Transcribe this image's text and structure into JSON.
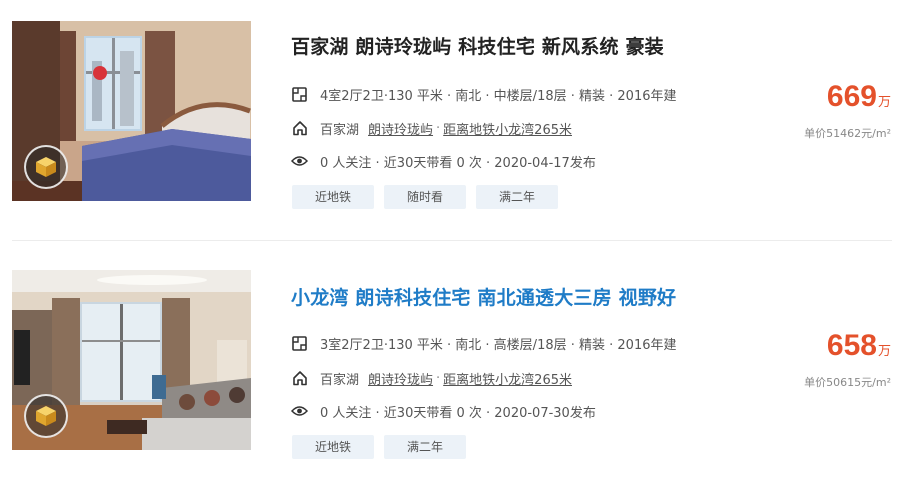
{
  "listings": [
    {
      "title": "百家湖 朗诗玲珑屿 科技住宅 新风系统 豪装",
      "house_info": "4室2厅2卫·130 平米 · 南北 · 中楼层/18层 · 精装 · 2016年建",
      "area": "百家湖",
      "community": "朗诗玲珑屿",
      "subway": "距离地铁小龙湾265米",
      "follow_info": "0 人关注 · 近30天带看 0 次 · 2020-04-17发布",
      "tags": [
        "近地铁",
        "随时看",
        "满二年"
      ],
      "total_price": "669",
      "total_unit": "万",
      "unit_price": "单价51462元/m²"
    },
    {
      "title": "小龙湾 朗诗科技住宅 南北通透大三房 视野好",
      "house_info": "3室2厅2卫·130 平米 · 南北 · 高楼层/18层 · 精装 · 2016年建",
      "area": "百家湖",
      "community": "朗诗玲珑屿",
      "subway": "距离地铁小龙湾265米",
      "follow_info": "0 人关注 · 近30天带看 0 次 · 2020-07-30发布",
      "tags": [
        "近地铁",
        "满二年"
      ],
      "total_price": "658",
      "total_unit": "万",
      "unit_price": "单价50615元/m²"
    }
  ],
  "icons": {
    "house_info": "floorplan-icon",
    "position": "home-icon",
    "follow": "eye-icon",
    "vr": "vr-cube-icon"
  },
  "colors": {
    "price": "#e4512b",
    "title_hover": "#1f7cc7",
    "tag_bg": "#ecf2f8"
  }
}
